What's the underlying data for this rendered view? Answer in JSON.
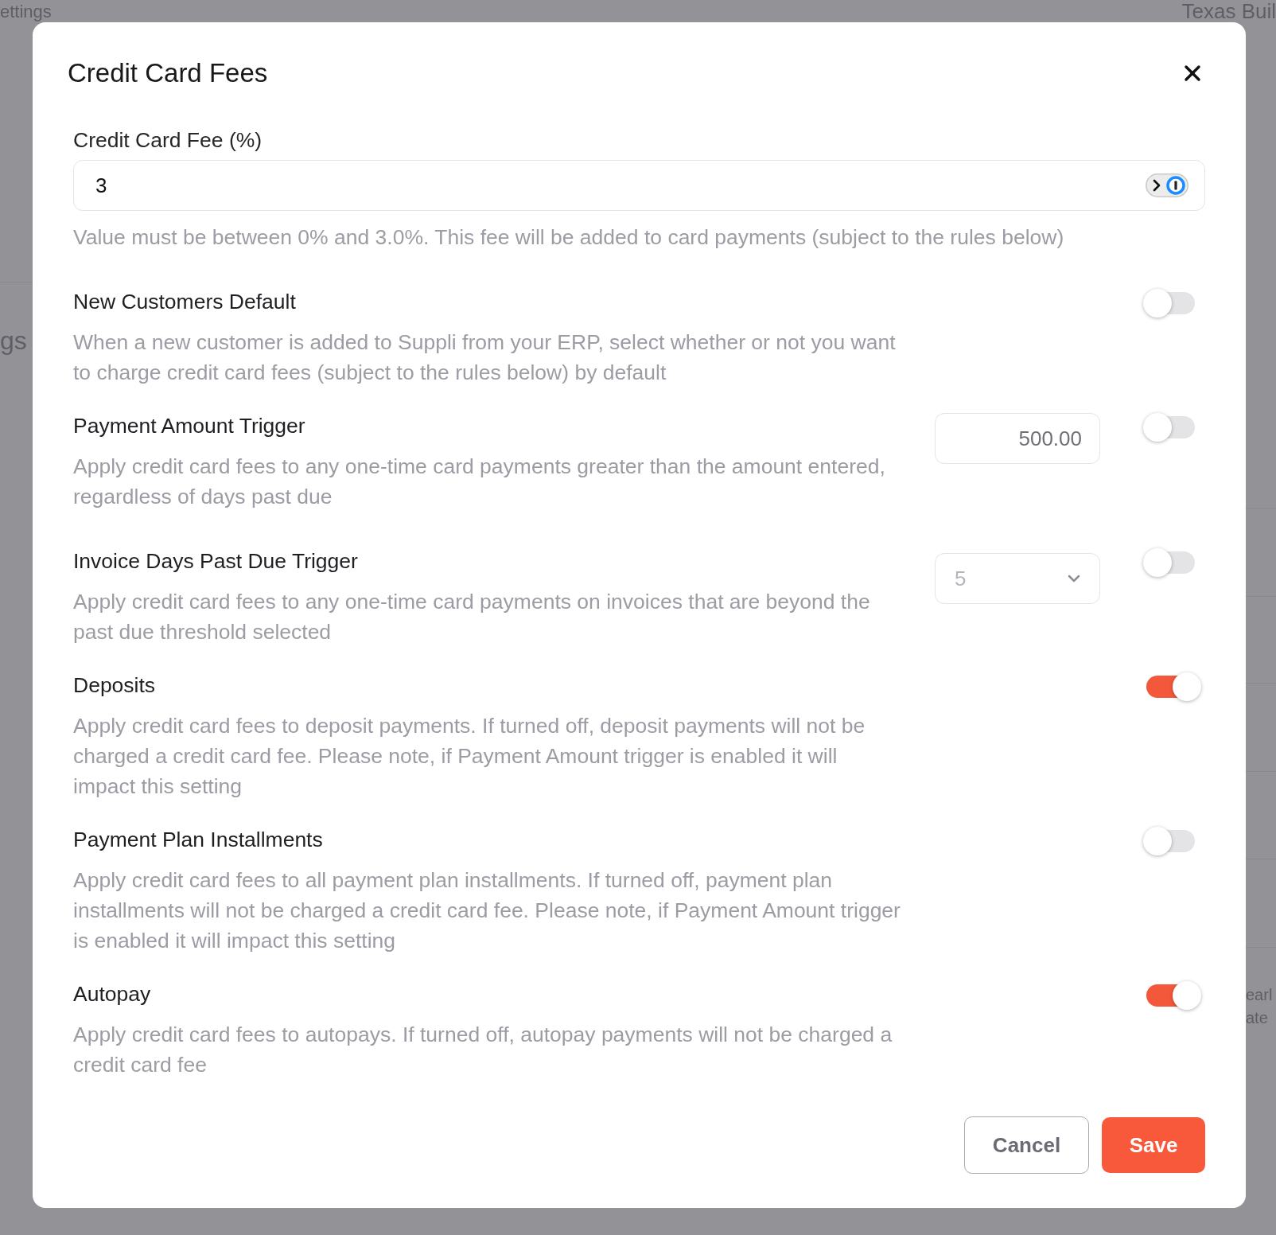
{
  "background_page": {
    "header_left": "ettings",
    "header_right": "Texas Buil",
    "left_edge": [
      "gs"
    ],
    "right_edge": [
      "earl",
      "ate"
    ]
  },
  "modal": {
    "title": "Credit Card Fees",
    "fee_field": {
      "label": "Credit Card Fee (%)",
      "value": "3",
      "help": "Value must be between 0% and 3.0%. This fee will be added to card payments (subject to the rules below)"
    },
    "settings": [
      {
        "kind": "toggle",
        "title": "New Customers Default",
        "description": "When a new customer is added to Suppli from your ERP, select whether or not you want to charge credit card fees (subject to the rules below) by default",
        "on": false
      },
      {
        "kind": "amount",
        "title": "Payment Amount Trigger",
        "description": "Apply credit card fees to any one-time card payments greater than the amount entered, regardless of days past due",
        "value": "500.00",
        "on": false
      },
      {
        "kind": "select",
        "title": "Invoice Days Past Due Trigger",
        "description": "Apply credit card fees to any one-time card payments on invoices that are beyond the past due threshold selected",
        "value": "5",
        "disabled": true,
        "on": false
      },
      {
        "kind": "toggle",
        "title": "Deposits",
        "description": "Apply credit card fees to deposit payments. If turned off, deposit payments will not be charged a credit card fee. Please note, if Payment Amount trigger is enabled it will impact this setting",
        "on": true
      },
      {
        "kind": "toggle",
        "title": "Payment Plan Installments",
        "description": "Apply credit card fees to all payment plan installments. If turned off, payment plan installments will not be charged a credit card fee. Please note, if Payment Amount trigger is enabled it will impact this setting",
        "on": false
      },
      {
        "kind": "toggle",
        "title": "Autopay",
        "description": "Apply credit card fees to autopays. If turned off, autopay payments will not be charged a credit card fee",
        "on": true
      }
    ],
    "buttons": [
      {
        "kind": "secondary",
        "label": "Cancel"
      },
      {
        "kind": "primary",
        "label": "Save"
      }
    ]
  }
}
